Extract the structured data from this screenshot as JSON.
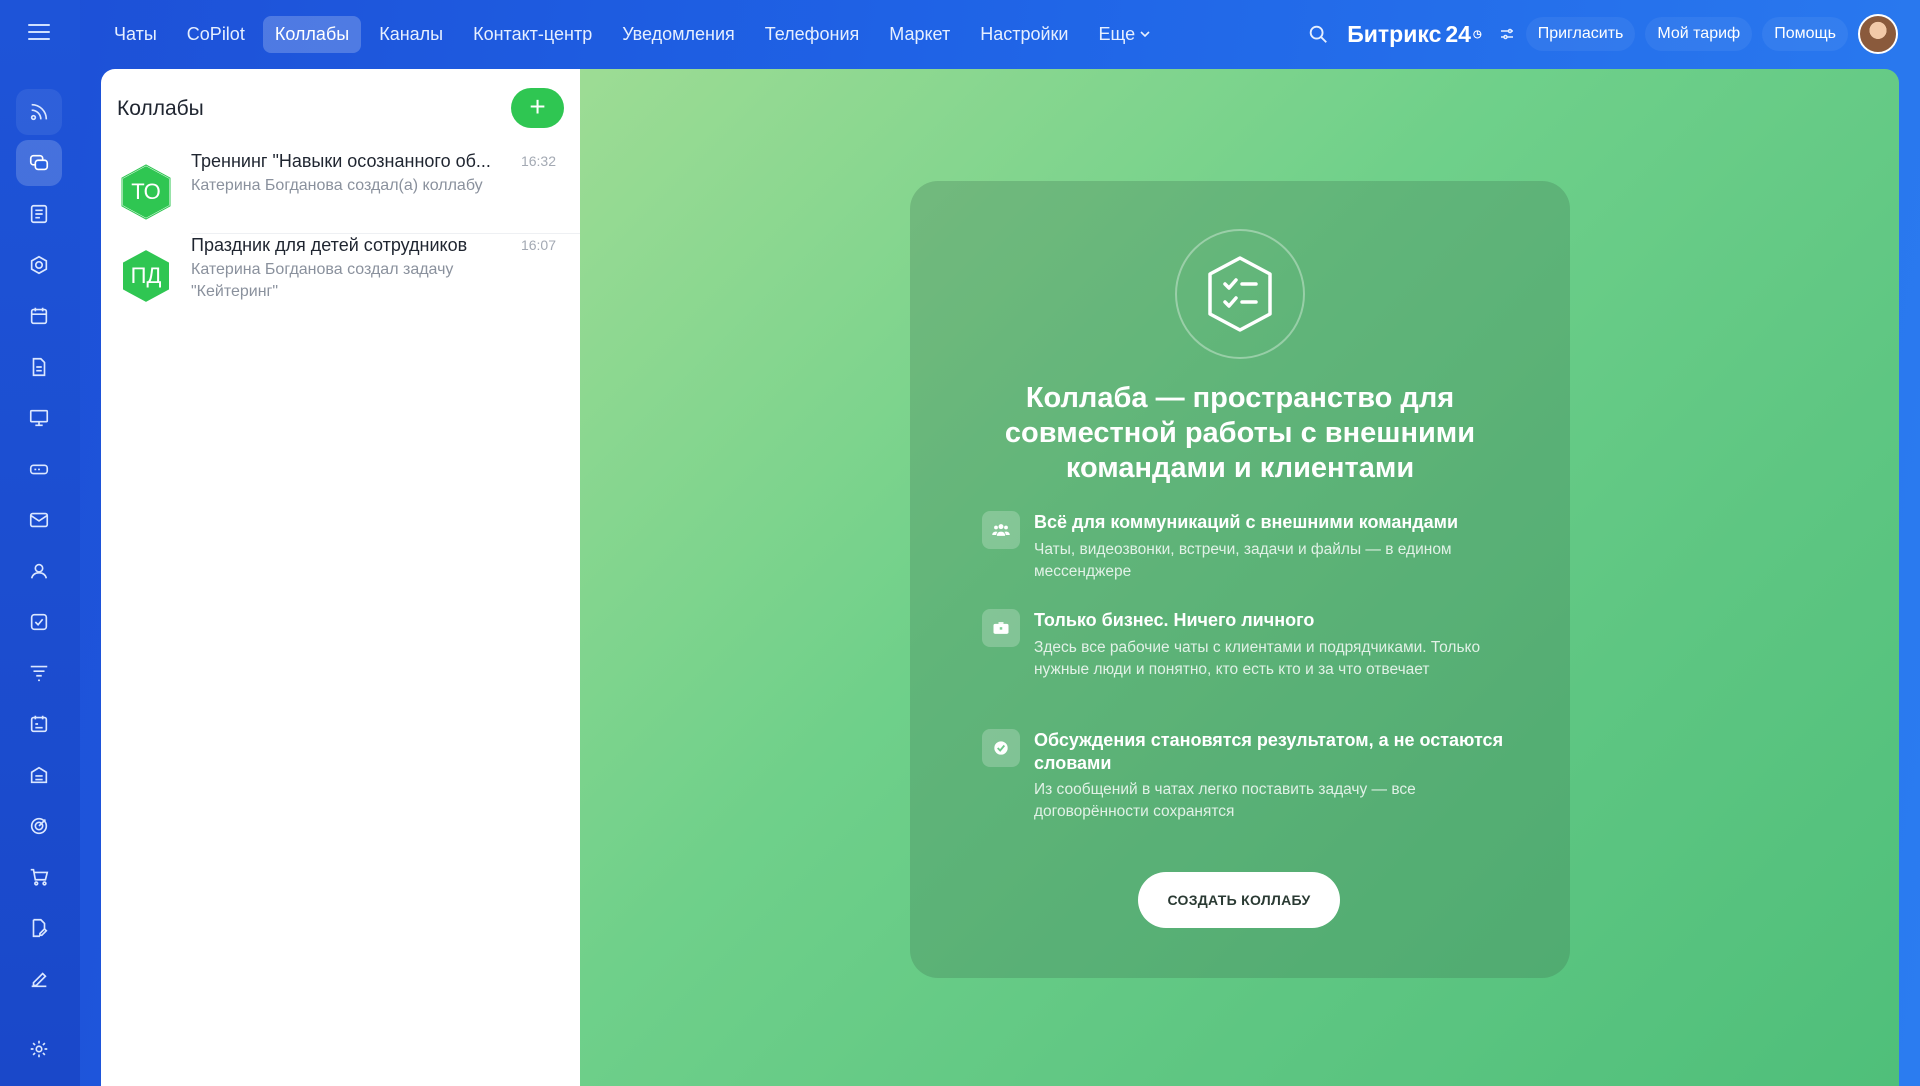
{
  "topnav": {
    "tabs": [
      "Чаты",
      "CoPilot",
      "Коллабы",
      "Каналы",
      "Контакт-центр",
      "Уведомления",
      "Телефония",
      "Маркет",
      "Настройки"
    ],
    "more_label": "Еще",
    "active_tab": "Коллабы"
  },
  "header": {
    "brand": "Битрикс",
    "brand_num": "24",
    "invite": "Пригласить",
    "tariff": "Мой тариф",
    "help": "Помощь"
  },
  "rail": {
    "icons": [
      "feed-icon",
      "chat-icon",
      "news-icon",
      "groups-icon",
      "calendar-icon",
      "docs-icon",
      "presentation-icon",
      "drive-icon",
      "mail-icon",
      "contacts-icon",
      "tasks-icon",
      "filter-icon",
      "planner-icon",
      "store-icon",
      "target-icon",
      "cart-icon",
      "edit-doc-icon",
      "sign-icon",
      "settings-icon"
    ]
  },
  "panel": {
    "title": "Коллабы",
    "add_label": "+",
    "items": [
      {
        "initials": "ТО",
        "title": "Треннинг \"Навыки осознанного об...",
        "subtitle": "Катерина Богданова создал(а) коллабу",
        "time": "16:32"
      },
      {
        "initials": "ПД",
        "title": "Праздник для детей сотрудников",
        "subtitle": "Катерина Богданова создал задачу \"Кейтеринг\"",
        "time": "16:07"
      }
    ]
  },
  "promo": {
    "title": "Коллаба — пространство для совместной работы с внешними командами и клиентами",
    "features": [
      {
        "icon": "people-icon",
        "title": "Всё для коммуникаций с внешними командами",
        "desc": "Чаты, видеозвонки, встречи, задачи и файлы — в едином мессенджере"
      },
      {
        "icon": "briefcase-icon",
        "title": "Только бизнес. Ничего личного",
        "desc": "Здесь все рабочие чаты с клиентами и подрядчиками. Только нужные люди и понятно, кто есть кто и за что отвечает"
      },
      {
        "icon": "check-circle-icon",
        "title": "Обсуждения становятся результатом, а не остаются словами",
        "desc": "Из сообщений в чатах легко поставить задачу — все договорённости сохранятся"
      }
    ],
    "cta": "СОЗДАТЬ КОЛЛАБУ"
  },
  "colors": {
    "accent_green": "#2fc652",
    "brand_blue": "#1f5fe3"
  }
}
